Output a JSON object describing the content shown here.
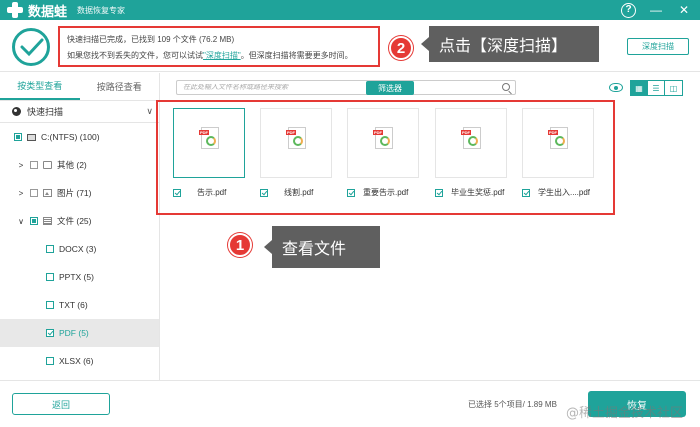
{
  "titlebar": {
    "app_name": "数据蛙",
    "subtitle": "数据恢复专家",
    "help": "?",
    "minimize": "—",
    "close": "✕"
  },
  "status": {
    "line1": "快速扫描已完成，已找到 109 个文件 (76.2 MB)",
    "line2_prefix": "如果您找不到丢失的文件，您可以试试",
    "line2_link": "\"深度扫描\"",
    "line2_suffix": "。但深度扫描将需要更多时间。",
    "deep_scan_button": "深度扫描"
  },
  "annotations": {
    "callout1_num": "1",
    "callout1_text": "查看文件",
    "callout2_num": "2",
    "callout2_text": "点击【深度扫描】"
  },
  "sidebar": {
    "tabs": [
      "按类型查看",
      "按路径查看"
    ],
    "quick_scan": "快速扫描",
    "tree": [
      {
        "label": "C:(NTFS) (100)",
        "indent": 0
      },
      {
        "label": "其他 (2)",
        "indent": 1
      },
      {
        "label": "图片 (71)",
        "indent": 1
      },
      {
        "label": "文件 (25)",
        "indent": 1
      },
      {
        "label": "DOCX (3)",
        "indent": 2
      },
      {
        "label": "PPTX (5)",
        "indent": 2
      },
      {
        "label": "TXT (6)",
        "indent": 2
      },
      {
        "label": "PDF (5)",
        "indent": 2
      },
      {
        "label": "XLSX (6)",
        "indent": 2
      }
    ]
  },
  "toolbar": {
    "search_placeholder": "在此处输入文件名称或路径来搜索",
    "filter_button": "筛选器"
  },
  "files": [
    {
      "name": "告示.pdf"
    },
    {
      "name": "线割.pdf"
    },
    {
      "name": "重要告示.pdf"
    },
    {
      "name": "毕业生奖惩.pdf"
    },
    {
      "name": "学生出入....pdf"
    }
  ],
  "footer": {
    "back_button": "返回",
    "selection_info": "已选择 5个项目/ 1.89 MB",
    "recover_button": "恢复",
    "watermark": "@稀土掘金技术社区"
  },
  "colors": {
    "accent": "#1fa39a",
    "highlight": "#e53935",
    "callout": "#5f5f5f"
  }
}
